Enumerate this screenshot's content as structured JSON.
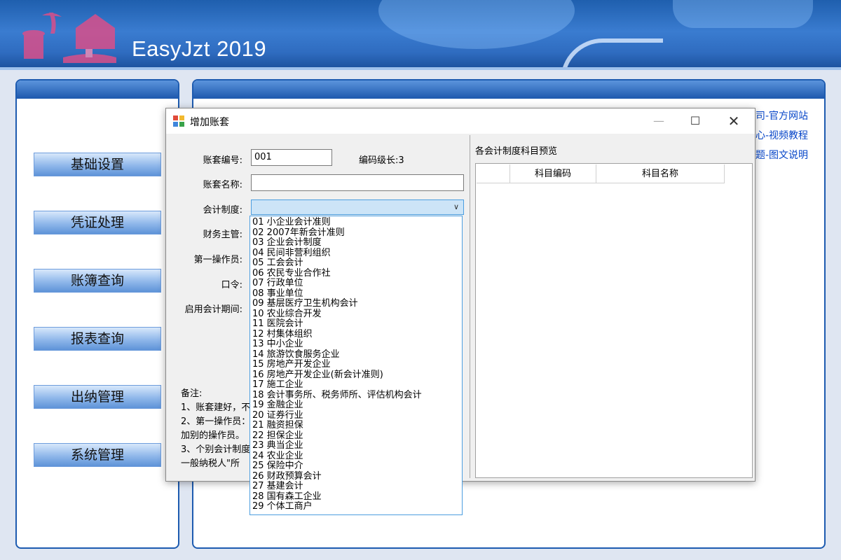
{
  "app": {
    "title": "EasyJzt 2019"
  },
  "sidebar": {
    "items": [
      {
        "label": "基础设置"
      },
      {
        "label": "凭证处理"
      },
      {
        "label": "账簿查询"
      },
      {
        "label": "报表查询"
      },
      {
        "label": "出纳管理"
      },
      {
        "label": "系统管理"
      }
    ]
  },
  "links": [
    {
      "label": "公司-官方网站"
    },
    {
      "label": "中心-视频教程"
    },
    {
      "label": "问题-图文说明"
    }
  ],
  "dialog": {
    "title": "增加账套",
    "form": {
      "code_label": "账套编号:",
      "code_value": "001",
      "code_length": "编码级长:3",
      "name_label": "账套名称:",
      "system_label": "会计制度:",
      "manager_label": "财务主管:",
      "operator_label": "第一操作员:",
      "password_label": "口令:",
      "period_label": "启用会计期间:"
    },
    "notes": {
      "heading": "备注:",
      "lines": [
        "1、账套建好，不",
        "2、第一操作员：",
        "加别的操作员。",
        "3、个别会计制度",
        "一般纳税人\"所"
      ]
    },
    "preview": {
      "caption": "各会计制度科目预览",
      "columns": [
        "",
        "科目编码",
        "科目名称"
      ]
    },
    "dropdown": [
      "01  小企业会计准则",
      "02  2007年新会计准则",
      "03  企业会计制度",
      "04  民间非营利组织",
      "05  工会会计",
      "06  农民专业合作社",
      "07  行政单位",
      "08  事业单位",
      "09  基层医疗卫生机构会计",
      "10  农业综合开发",
      "11  医院会计",
      "12  村集体组织",
      "13  中小企业",
      "14  旅游饮食服务企业",
      "15  房地产开发企业",
      "16  房地产开发企业(新会计准则)",
      "17  施工企业",
      "18  会计事务所、税务师所、评估机构会计",
      "19  金融企业",
      "20  证券行业",
      "21  融资担保",
      "22  担保企业",
      "23  典当企业",
      "24  农业企业",
      "25  保险中介",
      "26  财政预算会计",
      "27  基建会计",
      "28  国有森工企业",
      "29  个体工商户"
    ]
  },
  "colors": {
    "banner": "#2f6cc0",
    "panel_border": "#1d5bb0",
    "link": "#0645c8",
    "combo_highlight": "#cce4f7"
  }
}
